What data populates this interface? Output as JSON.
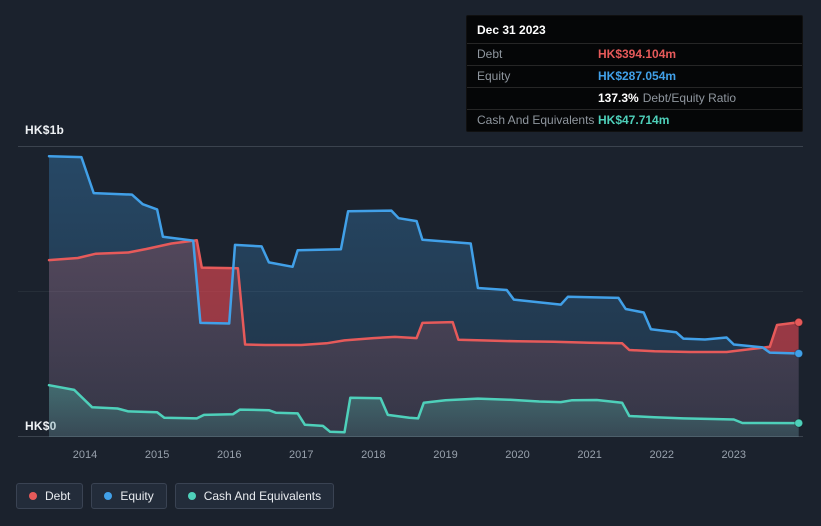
{
  "tooltip": {
    "date": "Dec 31 2023",
    "debt_label": "Debt",
    "debt_value": "HK$394.104m",
    "equity_label": "Equity",
    "equity_value": "HK$287.054m",
    "ratio_value": "137.3%",
    "ratio_label": "Debt/Equity Ratio",
    "cash_label": "Cash And Equivalents",
    "cash_value": "HK$47.714m"
  },
  "legend": {
    "items": [
      {
        "label": "Debt",
        "color": "#e65a5a"
      },
      {
        "label": "Equity",
        "color": "#41a0e8"
      },
      {
        "label": "Cash And Equivalents",
        "color": "#4ed0ba"
      }
    ]
  },
  "chart_data": {
    "type": "area",
    "x_axis": {
      "lim": [
        2013.07,
        2023.96
      ],
      "ticks": [
        "2014",
        "2015",
        "2016",
        "2017",
        "2018",
        "2019",
        "2020",
        "2021",
        "2022",
        "2023"
      ]
    },
    "y_axis": {
      "lim": [
        0,
        1000
      ],
      "unit": "HK$m",
      "gridlines": [
        1000,
        500,
        0
      ],
      "labels": [
        {
          "value": 1000,
          "text": "HK$1b"
        },
        {
          "value": 0,
          "text": "HK$0"
        }
      ]
    },
    "series": [
      {
        "name": "Debt",
        "color": "#e65a5a",
        "points": [
          [
            2013.5,
            608
          ],
          [
            2013.9,
            615
          ],
          [
            2014.15,
            630
          ],
          [
            2014.6,
            634
          ],
          [
            2014.85,
            646
          ],
          [
            2015.2,
            665
          ],
          [
            2015.55,
            676
          ],
          [
            2015.62,
            582
          ],
          [
            2016.12,
            580
          ],
          [
            2016.22,
            318
          ],
          [
            2016.5,
            316
          ],
          [
            2017.0,
            316
          ],
          [
            2017.35,
            322
          ],
          [
            2017.6,
            332
          ],
          [
            2018.0,
            340
          ],
          [
            2018.3,
            344
          ],
          [
            2018.6,
            340
          ],
          [
            2018.68,
            392
          ],
          [
            2019.1,
            395
          ],
          [
            2019.18,
            334
          ],
          [
            2019.5,
            332
          ],
          [
            2020.0,
            329
          ],
          [
            2020.5,
            327
          ],
          [
            2021.0,
            324
          ],
          [
            2021.45,
            322
          ],
          [
            2021.55,
            299
          ],
          [
            2021.9,
            295
          ],
          [
            2022.4,
            292
          ],
          [
            2022.9,
            292
          ],
          [
            2023.1,
            298
          ],
          [
            2023.5,
            310
          ],
          [
            2023.6,
            385
          ],
          [
            2023.9,
            394.1
          ]
        ]
      },
      {
        "name": "Equity",
        "color": "#41a0e8",
        "points": [
          [
            2013.5,
            965
          ],
          [
            2013.95,
            962
          ],
          [
            2014.12,
            838
          ],
          [
            2014.65,
            833
          ],
          [
            2014.8,
            800
          ],
          [
            2015.0,
            782
          ],
          [
            2015.08,
            688
          ],
          [
            2015.5,
            675
          ],
          [
            2015.6,
            392
          ],
          [
            2016.0,
            390
          ],
          [
            2016.08,
            660
          ],
          [
            2016.45,
            655
          ],
          [
            2016.55,
            600
          ],
          [
            2016.88,
            585
          ],
          [
            2016.95,
            642
          ],
          [
            2017.55,
            645
          ],
          [
            2017.65,
            776
          ],
          [
            2018.25,
            778
          ],
          [
            2018.35,
            752
          ],
          [
            2018.6,
            742
          ],
          [
            2018.68,
            678
          ],
          [
            2019.35,
            665
          ],
          [
            2019.45,
            512
          ],
          [
            2019.85,
            505
          ],
          [
            2019.95,
            472
          ],
          [
            2020.6,
            455
          ],
          [
            2020.7,
            482
          ],
          [
            2021.4,
            478
          ],
          [
            2021.5,
            440
          ],
          [
            2021.75,
            428
          ],
          [
            2021.85,
            370
          ],
          [
            2022.2,
            360
          ],
          [
            2022.3,
            338
          ],
          [
            2022.6,
            335
          ],
          [
            2022.9,
            342
          ],
          [
            2023.0,
            318
          ],
          [
            2023.4,
            308
          ],
          [
            2023.5,
            290
          ],
          [
            2023.9,
            287.1
          ]
        ]
      },
      {
        "name": "Cash And Equivalents",
        "color": "#4ed0ba",
        "points": [
          [
            2013.5,
            178
          ],
          [
            2013.85,
            162
          ],
          [
            2014.1,
            102
          ],
          [
            2014.45,
            98
          ],
          [
            2014.6,
            88
          ],
          [
            2015.0,
            85
          ],
          [
            2015.1,
            66
          ],
          [
            2015.55,
            64
          ],
          [
            2015.65,
            76
          ],
          [
            2016.05,
            78
          ],
          [
            2016.15,
            94
          ],
          [
            2016.55,
            92
          ],
          [
            2016.65,
            83
          ],
          [
            2016.95,
            81
          ],
          [
            2017.05,
            42
          ],
          [
            2017.3,
            38
          ],
          [
            2017.4,
            18
          ],
          [
            2017.6,
            16
          ],
          [
            2017.68,
            135
          ],
          [
            2018.1,
            133
          ],
          [
            2018.2,
            76
          ],
          [
            2018.5,
            66
          ],
          [
            2018.62,
            64
          ],
          [
            2018.7,
            118
          ],
          [
            2019.0,
            126
          ],
          [
            2019.45,
            132
          ],
          [
            2019.9,
            128
          ],
          [
            2020.3,
            122
          ],
          [
            2020.6,
            120
          ],
          [
            2020.75,
            126
          ],
          [
            2021.1,
            127
          ],
          [
            2021.45,
            118
          ],
          [
            2021.55,
            72
          ],
          [
            2021.9,
            68
          ],
          [
            2022.3,
            64
          ],
          [
            2022.7,
            62
          ],
          [
            2023.0,
            60
          ],
          [
            2023.12,
            48
          ],
          [
            2023.9,
            47.7
          ]
        ]
      }
    ],
    "highlight": {
      "name": "debt-exceeds-equity",
      "color": "rgba(225,70,82,0.55)"
    }
  }
}
